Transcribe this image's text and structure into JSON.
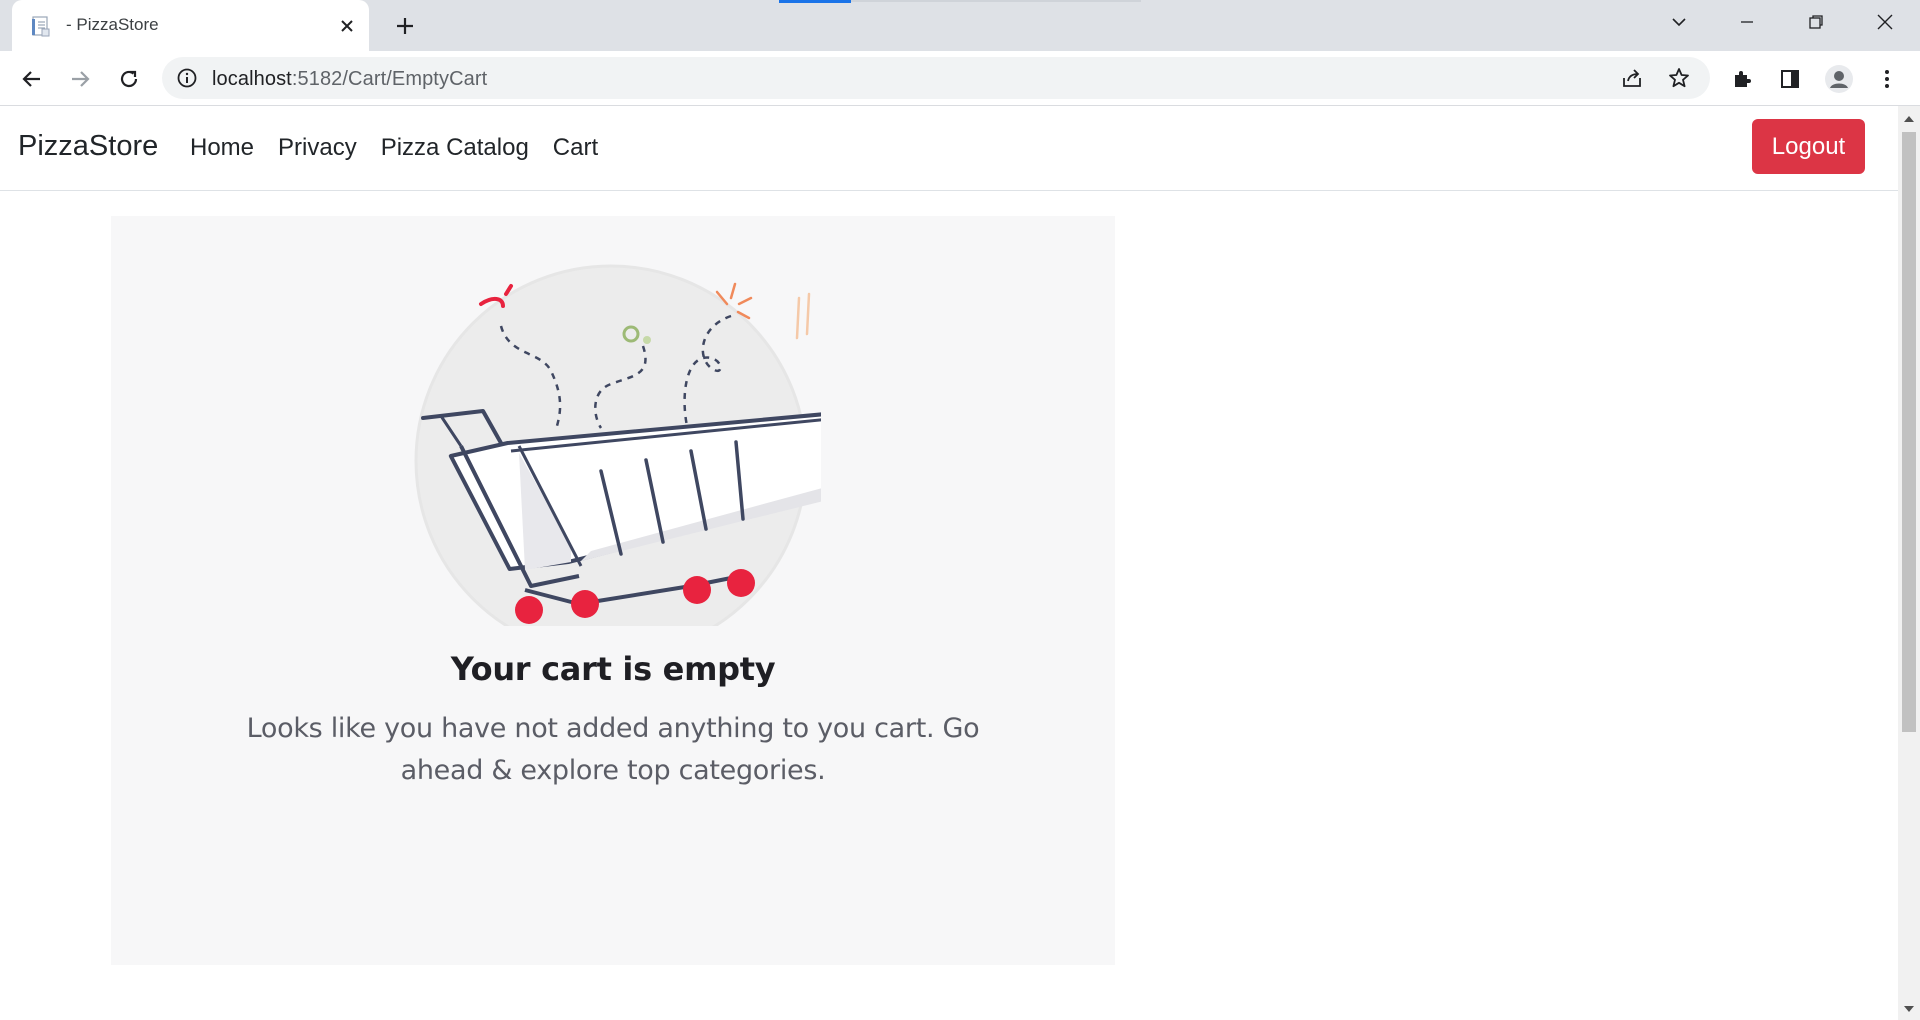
{
  "browser": {
    "tab_title": "- PizzaStore",
    "url_host": "localhost",
    "url_path": ":5182/Cart/EmptyCart",
    "accent_color": "#1a73e8"
  },
  "navbar": {
    "brand": "PizzaStore",
    "links": [
      "Home",
      "Privacy",
      "Pizza Catalog",
      "Cart"
    ],
    "logout_label": "Logout",
    "logout_color": "#dc3545"
  },
  "empty_cart": {
    "title": "Your cart is empty",
    "description": "Looks like you have not added anything to you cart. Go ahead & explore top categories.",
    "illustration": "empty-shopping-cart",
    "wheel_color": "#e8233f"
  }
}
